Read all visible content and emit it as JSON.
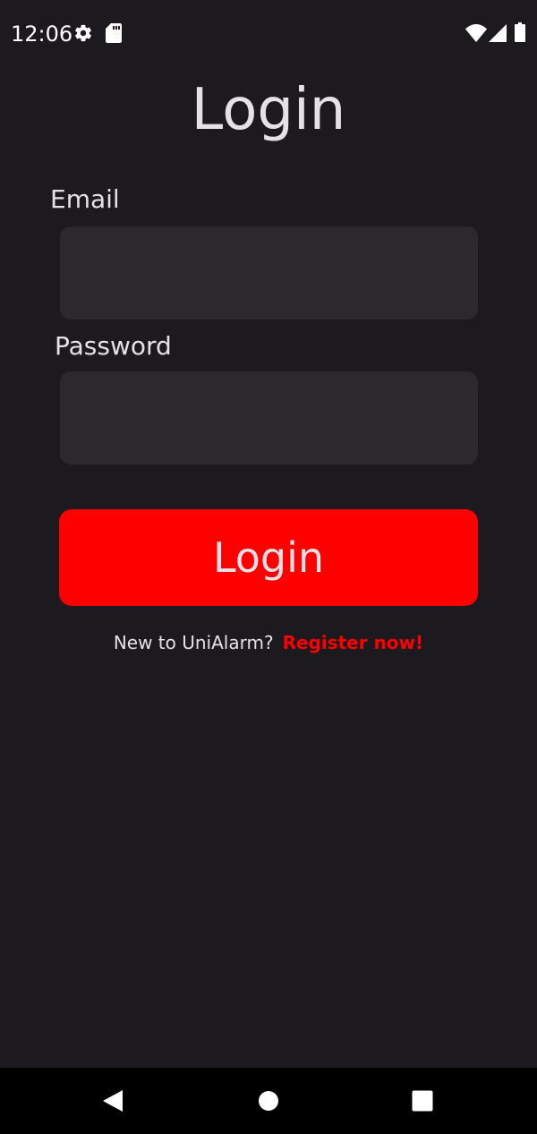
{
  "status_bar": {
    "time": "12:06",
    "icons_left": [
      "gear-icon",
      "sd-card-icon"
    ],
    "icons_right": [
      "wifi-icon",
      "cellular-signal-icon",
      "battery-icon"
    ]
  },
  "page": {
    "title": "Login"
  },
  "form": {
    "email_label": "Email",
    "email_value": "",
    "password_label": "Password",
    "password_value": "",
    "login_button_label": "Login"
  },
  "register": {
    "prompt": "New to UniAlarm?",
    "link_label": "Register now!"
  },
  "nav_bar": {
    "buttons": [
      "back-icon",
      "home-icon",
      "recents-icon"
    ]
  },
  "colors": {
    "background": "#1c1a1e",
    "field_background": "#2b292d",
    "accent": "#fe0000",
    "text": "#e6e1e6"
  }
}
